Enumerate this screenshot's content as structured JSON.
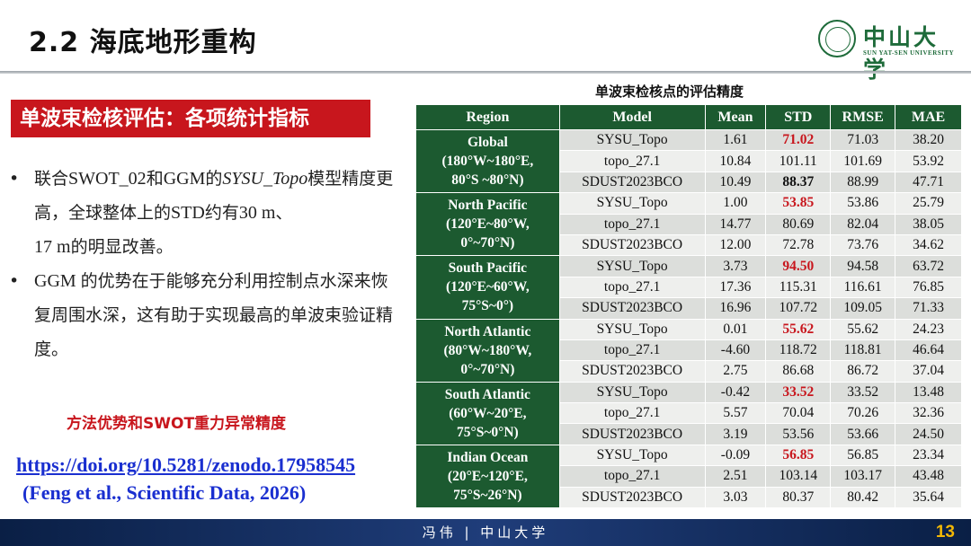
{
  "slide_title": "2.2 海底地形重构",
  "logo": {
    "name_cn": "中山大学",
    "name_en": "SUN YAT-SEN UNIVERSITY"
  },
  "subtitle": "单波束检核评估：各项统计指标",
  "bullets": [
    {
      "prefix": "联合",
      "latin1": "SWOT_02",
      "mid1": "和",
      "latin2": "GGM",
      "mid2": "的",
      "italic": "SYSU_Topo",
      "suffix": "模型精度更高，全球整体上的",
      "latin3": "STD",
      "mid3": "约有",
      "latin4": "30 m",
      "mid4": "、",
      "latin5": "17 m",
      "end": "的明显改善。"
    },
    {
      "latin1": "GGM ",
      "text": "的优势在于能够充分利用控制点水深来恢复周围水深，这有助于实现最高的单波束验证精度。"
    }
  ],
  "highlight": "方法优势和SWOT重力异常精度",
  "link": "https://doi.org/10.5281/zenodo.17958545",
  "citation": "(Feng et al., Scientific Data, 2026)",
  "table": {
    "caption": "单波束检核点的评估精度",
    "headers": [
      "Region",
      "Model",
      "Mean",
      "STD",
      "RMSE",
      "MAE"
    ],
    "groups": [
      {
        "region": [
          "Global",
          "(180°W~180°E,",
          "80°S ~80°N)"
        ],
        "rows": [
          [
            "SYSU_Topo",
            "1.61",
            "71.02",
            "71.03",
            "38.20"
          ],
          [
            "topo_27.1",
            "10.84",
            "101.11",
            "101.69",
            "53.92"
          ],
          [
            "SDUST2023BCO",
            "10.49",
            "88.37",
            "88.99",
            "47.71"
          ]
        ]
      },
      {
        "region": [
          "North Pacific",
          "(120°E~80°W,",
          "0°~70°N)"
        ],
        "rows": [
          [
            "SYSU_Topo",
            "1.00",
            "53.85",
            "53.86",
            "25.79"
          ],
          [
            "topo_27.1",
            "14.77",
            "80.69",
            "82.04",
            "38.05"
          ],
          [
            "SDUST2023BCO",
            "12.00",
            "72.78",
            "73.76",
            "34.62"
          ]
        ]
      },
      {
        "region": [
          "South Pacific",
          "(120°E~60°W,",
          "75°S~0°)"
        ],
        "rows": [
          [
            "SYSU_Topo",
            "3.73",
            "94.50",
            "94.58",
            "63.72"
          ],
          [
            "topo_27.1",
            "17.36",
            "115.31",
            "116.61",
            "76.85"
          ],
          [
            "SDUST2023BCO",
            "16.96",
            "107.72",
            "109.05",
            "71.33"
          ]
        ]
      },
      {
        "region": [
          "North Atlantic",
          "(80°W~180°W,",
          "0°~70°N)"
        ],
        "rows": [
          [
            "SYSU_Topo",
            "0.01",
            "55.62",
            "55.62",
            "24.23"
          ],
          [
            "topo_27.1",
            "-4.60",
            "118.72",
            "118.81",
            "46.64"
          ],
          [
            "SDUST2023BCO",
            "2.75",
            "86.68",
            "86.72",
            "37.04"
          ]
        ]
      },
      {
        "region": [
          "South Atlantic",
          "(60°W~20°E,",
          "75°S~0°N)"
        ],
        "rows": [
          [
            "SYSU_Topo",
            "-0.42",
            "33.52",
            "33.52",
            "13.48"
          ],
          [
            "topo_27.1",
            "5.57",
            "70.04",
            "70.26",
            "32.36"
          ],
          [
            "SDUST2023BCO",
            "3.19",
            "53.56",
            "53.66",
            "24.50"
          ]
        ]
      },
      {
        "region": [
          "Indian Ocean",
          "(20°E~120°E,",
          "75°S~26°N)"
        ],
        "rows": [
          [
            "SYSU_Topo",
            "-0.09",
            "56.85",
            "56.85",
            "23.34"
          ],
          [
            "topo_27.1",
            "2.51",
            "103.14",
            "103.17",
            "43.48"
          ],
          [
            "SDUST2023BCO",
            "3.03",
            "80.37",
            "80.42",
            "35.64"
          ]
        ]
      }
    ],
    "emphasis": {
      "red_std_row": 0,
      "bold_std_row_global": 2
    }
  },
  "footer": {
    "text": "冯伟  |  中山大学",
    "page": "13"
  },
  "colors": {
    "accent_red": "#c8161d",
    "table_green": "#1c5a30",
    "link_blue": "#1a2fd0",
    "footer_navy": "#0a1f45",
    "page_num_gold": "#f2b705"
  }
}
